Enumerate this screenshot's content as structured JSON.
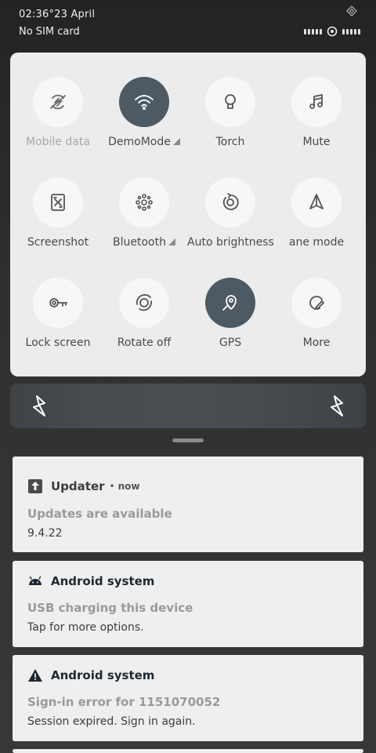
{
  "status_bar": {
    "time": "02:36°23 April",
    "sim": "No SIM card"
  },
  "quick_settings": {
    "tiles": [
      {
        "label": "Mobile data",
        "icon": "mobile-data-off-icon",
        "active": false,
        "dim": true
      },
      {
        "label": "DemoMode",
        "icon": "wifi-icon",
        "active": true,
        "dim": false
      },
      {
        "label": "Torch",
        "icon": "torch-icon",
        "active": false,
        "dim": false
      },
      {
        "label": "Mute",
        "icon": "music-note-icon",
        "active": false,
        "dim": false
      },
      {
        "label": "Screenshot",
        "icon": "screenshot-icon",
        "active": false,
        "dim": false
      },
      {
        "label": "Bluetooth",
        "icon": "bluetooth-icon",
        "active": false,
        "dim": false
      },
      {
        "label": "Auto brightness",
        "icon": "auto-brightness-icon",
        "active": false,
        "dim": false
      },
      {
        "label": "ane mode",
        "icon": "airplane-icon",
        "active": false,
        "dim": false
      },
      {
        "label": "Lock screen",
        "icon": "key-icon",
        "active": false,
        "dim": false
      },
      {
        "label": "Rotate off",
        "icon": "rotate-icon",
        "active": false,
        "dim": false
      },
      {
        "label": "GPS",
        "icon": "location-icon",
        "active": true,
        "dim": false
      },
      {
        "label": "More",
        "icon": "edit-icon",
        "active": false,
        "dim": false
      }
    ]
  },
  "notifications": [
    {
      "app": "Updater",
      "time": "now",
      "icon": "upload-arrow-icon",
      "title": "Updates are available",
      "text": "9.4.22"
    },
    {
      "app": "Android system",
      "time": "",
      "icon": "android-icon",
      "title": "USB charging this device",
      "text": "Tap for more options."
    },
    {
      "app": "Android system",
      "time": "",
      "icon": "warning-icon",
      "title": "Sign-in error for 1151070052",
      "text": "Session expired. Sign in again."
    }
  ],
  "colors": {
    "active_tile": "#4d5963",
    "panel": "#ececec"
  }
}
